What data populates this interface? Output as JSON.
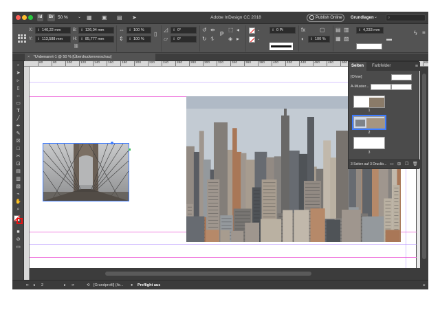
{
  "app": {
    "title": "Adobe InDesign CC 2018",
    "app_icon": "Id",
    "bridge_icon": "Br",
    "zoom": "50 %",
    "publish_label": "Publish Online",
    "workspace": "Grundlagen",
    "search_placeholder": ""
  },
  "control": {
    "x_label": "X:",
    "y_label": "Y:",
    "w_label": "B:",
    "h_label": "H:",
    "x_value": "140,22 mm",
    "y_value": "113,588 mm",
    "w_value": "126,04 mm",
    "h_value": "85,777 mm",
    "scale_x": "100 %",
    "scale_y": "100 %",
    "rotation": "0°",
    "shear": "0°",
    "stroke_weight": "0 Pt",
    "opacity": "100 %",
    "offset": "4,233 mm"
  },
  "tab": {
    "close": "×",
    "label": "*Unbenannt-1 @ 50 % [Überdruckenvorschau]"
  },
  "ruler": {
    "ticks": [
      "60",
      "80",
      "100",
      "120",
      "140",
      "160",
      "180",
      "200",
      "220",
      "240",
      "260",
      "280",
      "300",
      "320",
      "340",
      "360",
      "380",
      "400",
      "420",
      "440",
      "460",
      "480",
      "500",
      "520",
      "540",
      "560",
      "580",
      "600",
      "620"
    ]
  },
  "pages_panel": {
    "tab_pages": "Seiten",
    "tab_colors": "Farbfelder",
    "none_label": "[Ohne]",
    "master_label": "A-Muster...",
    "page_numbers": [
      "1",
      "2",
      "3"
    ],
    "footer": "3 Seiten auf 3 Druckb..."
  },
  "status": {
    "page_field": "2",
    "base_label": "[Grundprofil] (Ar...",
    "preflight": "Preflight aus"
  }
}
